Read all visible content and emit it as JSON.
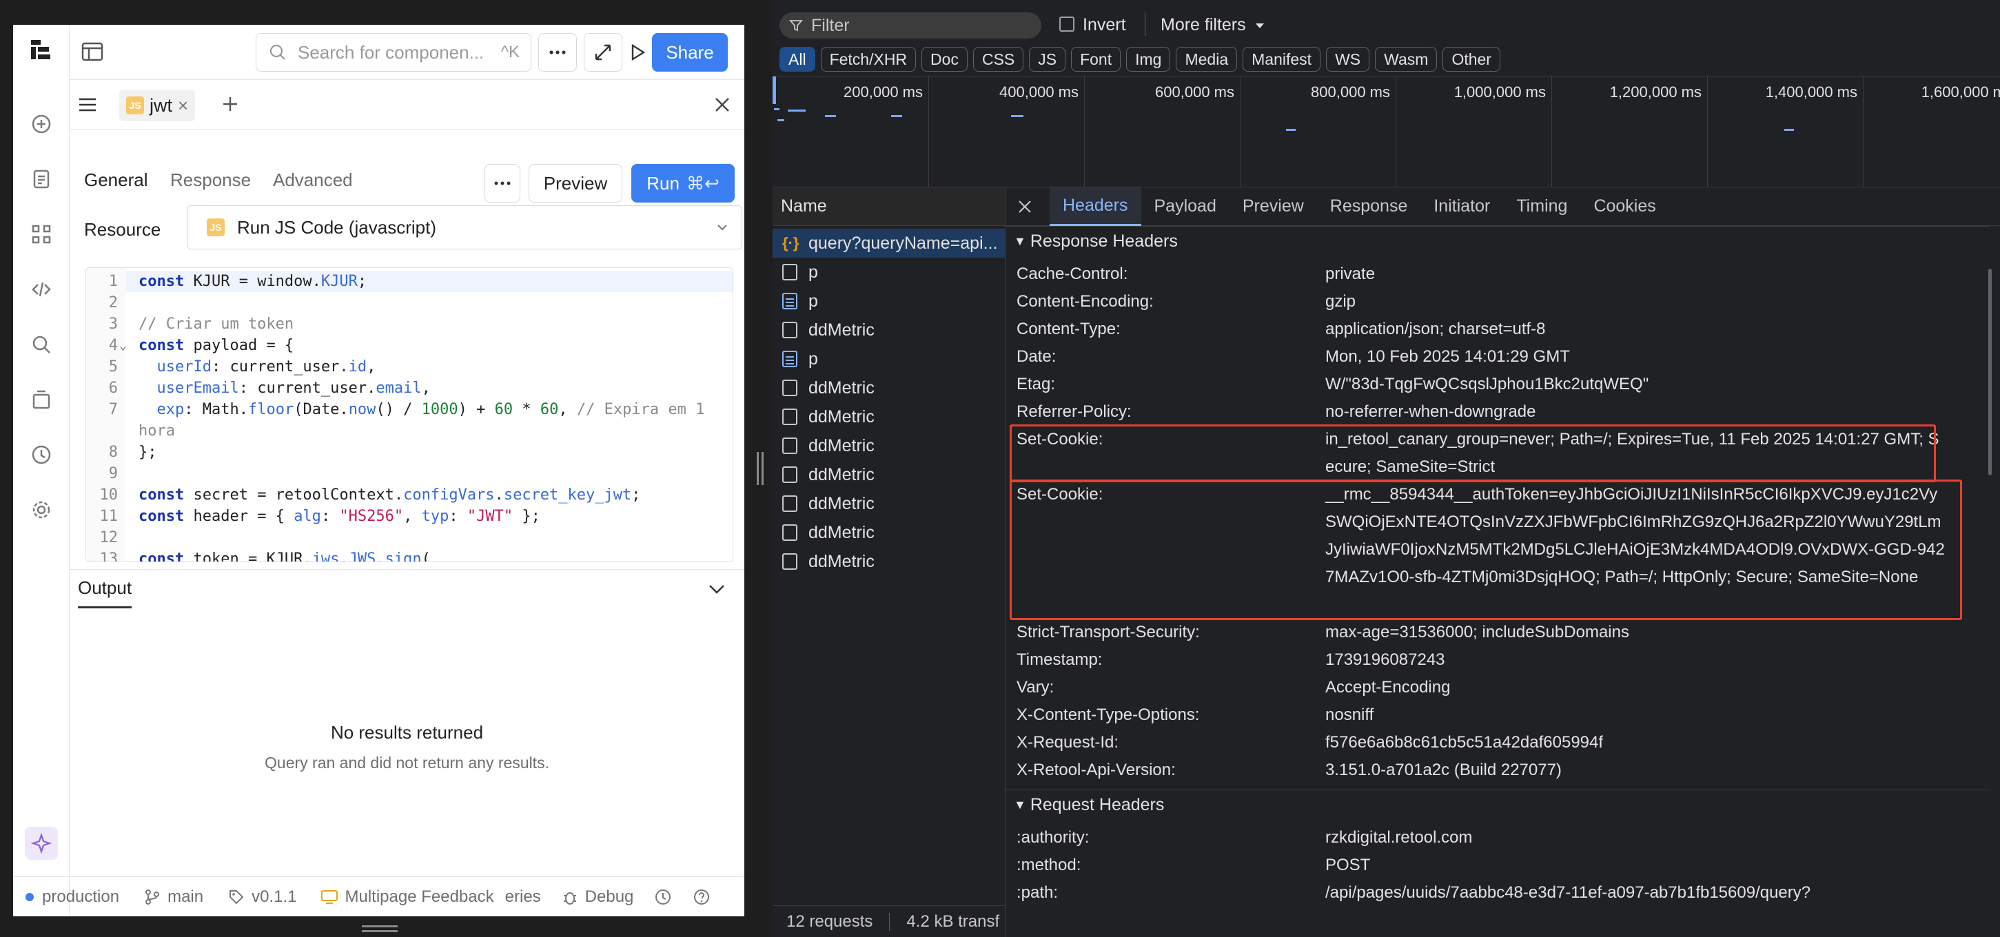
{
  "left": {
    "search": {
      "placeholder": "Search for componen...",
      "shortcut": "^K"
    },
    "share_label": "Share",
    "tab": {
      "badge": "JS",
      "name": "jwt",
      "close": "×"
    },
    "query_tabs": [
      "General",
      "Response",
      "Advanced"
    ],
    "preview_label": "Preview",
    "run_label": "Run",
    "run_shortcut": "⌘↩",
    "resource": {
      "label": "Resource",
      "badge": "JS",
      "value": "Run JS Code (javascript)"
    },
    "output": {
      "title": "Output",
      "empty_title": "No results returned",
      "empty_sub": "Query ran and did not return any results."
    },
    "footer": {
      "env": "production",
      "branch": "main",
      "version": "v0.1.1",
      "app": "Multipage Feedback",
      "queries": "eries",
      "debug": "Debug"
    }
  },
  "code_lines": [
    {
      "n": "1",
      "parts": [
        [
          "kw",
          "const"
        ],
        [
          "t",
          " KJUR = window."
        ],
        [
          "pr",
          "KJUR"
        ],
        [
          "t",
          ";"
        ]
      ]
    },
    {
      "n": "2",
      "parts": []
    },
    {
      "n": "3",
      "parts": [
        [
          "cm",
          "// Criar um token"
        ]
      ]
    },
    {
      "n": "4",
      "parts": [
        [
          "kw",
          "const"
        ],
        [
          "t",
          " payload = {"
        ]
      ]
    },
    {
      "n": "5",
      "parts": [
        [
          "t",
          "  "
        ],
        [
          "pr",
          "userId"
        ],
        [
          "t",
          ": current_user."
        ],
        [
          "pr",
          "id"
        ],
        [
          "t",
          ","
        ]
      ]
    },
    {
      "n": "6",
      "parts": [
        [
          "t",
          "  "
        ],
        [
          "pr",
          "userEmail"
        ],
        [
          "t",
          ": current_user."
        ],
        [
          "pr",
          "email"
        ],
        [
          "t",
          ","
        ]
      ]
    },
    {
      "n": "7",
      "parts": [
        [
          "t",
          "  "
        ],
        [
          "pr",
          "exp"
        ],
        [
          "t",
          ": Math."
        ],
        [
          "pr",
          "floor"
        ],
        [
          "t",
          "(Date."
        ],
        [
          "pr",
          "now"
        ],
        [
          "t",
          "() / "
        ],
        [
          "nm",
          "1000"
        ],
        [
          "t",
          ") + "
        ],
        [
          "nm",
          "60"
        ],
        [
          "t",
          " * "
        ],
        [
          "nm",
          "60"
        ],
        [
          "t",
          ", "
        ],
        [
          "cm",
          "// Expira em 1"
        ]
      ]
    },
    {
      "n": "",
      "parts": [
        [
          "cm",
          "hora"
        ]
      ]
    },
    {
      "n": "8",
      "parts": [
        [
          "t",
          "};"
        ]
      ]
    },
    {
      "n": "9",
      "parts": []
    },
    {
      "n": "10",
      "parts": [
        [
          "kw",
          "const"
        ],
        [
          "t",
          " secret = retoolContext."
        ],
        [
          "pr",
          "configVars"
        ],
        [
          "t",
          "."
        ],
        [
          "pr",
          "secret_key_jwt"
        ],
        [
          "t",
          ";"
        ]
      ]
    },
    {
      "n": "11",
      "parts": [
        [
          "kw",
          "const"
        ],
        [
          "t",
          " header = { "
        ],
        [
          "pr",
          "alg"
        ],
        [
          "t",
          ": "
        ],
        [
          "st",
          "\"HS256\""
        ],
        [
          "t",
          ", "
        ],
        [
          "pr",
          "typ"
        ],
        [
          "t",
          ": "
        ],
        [
          "st",
          "\"JWT\""
        ],
        [
          "t",
          " };"
        ]
      ]
    },
    {
      "n": "12",
      "parts": []
    },
    {
      "n": "13",
      "parts": [
        [
          "kw",
          "const"
        ],
        [
          "t",
          " token = KJUR."
        ],
        [
          "pr",
          "jws"
        ],
        [
          "t",
          "."
        ],
        [
          "pr",
          "JWS"
        ],
        [
          "t",
          "."
        ],
        [
          "pr",
          "sign"
        ],
        [
          "t",
          "("
        ]
      ]
    }
  ],
  "devtools": {
    "filter_placeholder": "Filter",
    "invert_label": "Invert",
    "more_filters": "More filters",
    "type_chips": [
      "All",
      "Fetch/XHR",
      "Doc",
      "CSS",
      "JS",
      "Font",
      "Img",
      "Media",
      "Manifest",
      "WS",
      "Wasm",
      "Other"
    ],
    "timeline_ticks": [
      "200,000 ms",
      "400,000 ms",
      "600,000 ms",
      "800,000 ms",
      "1,000,000 ms",
      "1,200,000 ms",
      "1,400,000 ms",
      "1,600,000 ms"
    ],
    "name_header": "Name",
    "requests": [
      "query?queryName=api...",
      "p",
      "p",
      "ddMetric",
      "p",
      "ddMetric",
      "ddMetric",
      "ddMetric",
      "ddMetric",
      "ddMetric",
      "ddMetric",
      "ddMetric"
    ],
    "status": {
      "requests": "12 requests",
      "transfer": "4.2 kB transf"
    },
    "detail_tabs": [
      "Headers",
      "Payload",
      "Preview",
      "Response",
      "Initiator",
      "Timing",
      "Cookies"
    ],
    "response_section": "Response Headers",
    "response_headers": [
      {
        "k": "Cache-Control:",
        "v": "private"
      },
      {
        "k": "Content-Encoding:",
        "v": "gzip"
      },
      {
        "k": "Content-Type:",
        "v": "application/json; charset=utf-8"
      },
      {
        "k": "Date:",
        "v": "Mon, 10 Feb 2025 14:01:29 GMT"
      },
      {
        "k": "Etag:",
        "v": "W/\"83d-TqgFwQCsqslJphou1Bkc2utqWEQ\""
      },
      {
        "k": "Referrer-Policy:",
        "v": "no-referrer-when-downgrade"
      },
      {
        "k": "Set-Cookie:",
        "v": "in_retool_canary_group=never; Path=/; Expires=Tue, 11 Feb 2025 14:01:27 GMT; Secure; SameSite=Strict"
      },
      {
        "k": "Set-Cookie:",
        "v": "__rmc__8594344__authToken=eyJhbGciOiJIUzI1NiIsInR5cCI6IkpXVCJ9.eyJ1c2VySWQiOjExNTE4OTQsInVzZXJFbWFpbCI6ImRhZG9zQHJ6a2RpZ2l0YWwuY29tLmJyIiwiaWF0IjoxNzM5MTk2MDg5LCJleHAiOjE3Mzk4MDA4ODl9.OVxDWX-GGD-9427MAZv1O0-sfb-4ZTMj0mi3DsjqHOQ; Path=/; HttpOnly; Secure; SameSite=None"
      },
      {
        "k": "Strict-Transport-Security:",
        "v": "max-age=31536000; includeSubDomains"
      },
      {
        "k": "Timestamp:",
        "v": "1739196087243"
      },
      {
        "k": "Vary:",
        "v": "Accept-Encoding"
      },
      {
        "k": "X-Content-Type-Options:",
        "v": "nosniff"
      },
      {
        "k": "X-Request-Id:",
        "v": "f576e6a6b8c61cb5c51a42daf605994f"
      },
      {
        "k": "X-Retool-Api-Version:",
        "v": "3.151.0-a701a2c (Build 227077)"
      }
    ],
    "request_section": "Request Headers",
    "request_headers": [
      {
        "k": ":authority:",
        "v": "rzkdigital.retool.com"
      },
      {
        "k": ":method:",
        "v": "POST"
      },
      {
        "k": ":path:",
        "v": "/api/pages/uuids/7aabbc48-e3d7-11ef-a097-ab7b1fb15609/query?"
      }
    ]
  }
}
